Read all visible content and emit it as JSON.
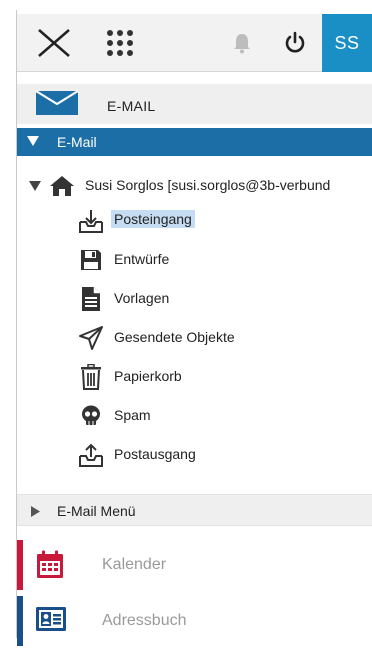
{
  "topbar": {
    "close_icon": "close-icon",
    "apps_icon": "apps-grid-icon",
    "bell_icon": "bell-icon",
    "power_icon": "power-icon",
    "avatar_initials": "SS",
    "avatar_color": "#1a8fc6"
  },
  "module_header": {
    "label": "E-MAIL",
    "icon": "mail-icon"
  },
  "section": {
    "label": "E-Mail",
    "color": "#1b6fa6"
  },
  "account": {
    "label": "Susi Sorglos [susi.sorglos@3b-verbund"
  },
  "folders": [
    {
      "label": "Posteingang",
      "icon": "inbox-icon",
      "selected": true
    },
    {
      "label": "Entwürfe",
      "icon": "floppy-disk-icon"
    },
    {
      "label": "Vorlagen",
      "icon": "template-document-icon"
    },
    {
      "label": "Gesendete Objekte",
      "icon": "paper-plane-icon"
    },
    {
      "label": "Papierkorb",
      "icon": "trash-icon"
    },
    {
      "label": "Spam",
      "icon": "skull-icon"
    },
    {
      "label": "Postausgang",
      "icon": "outbox-icon"
    }
  ],
  "email_menu": {
    "label": "E-Mail Menü"
  },
  "modules": [
    {
      "label": "Kalender",
      "icon": "calendar-icon",
      "accent": "#c8193c"
    },
    {
      "label": "Adressbuch",
      "icon": "address-card-icon",
      "accent": "#1b4f8a"
    }
  ]
}
